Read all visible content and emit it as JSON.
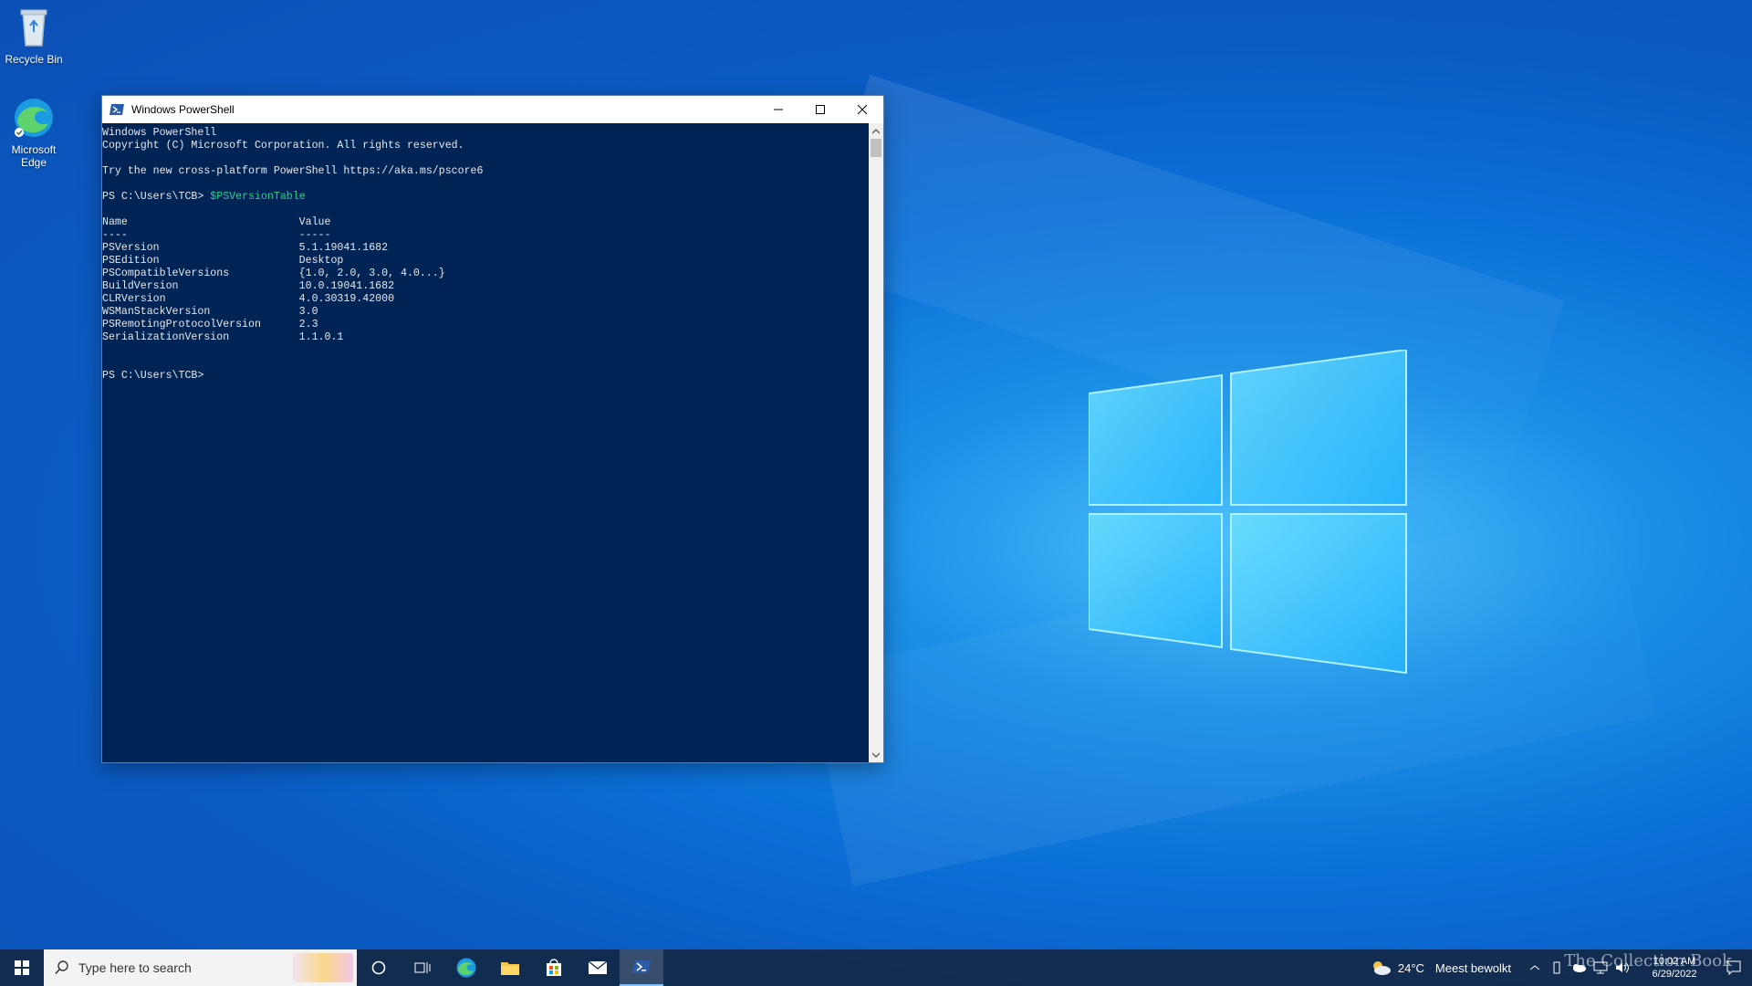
{
  "desktop": {
    "icons": [
      {
        "label": "Recycle Bin"
      },
      {
        "label": "Microsoft Edge"
      }
    ]
  },
  "window": {
    "title": "Windows PowerShell",
    "console_lines": [
      "Windows PowerShell",
      "Copyright (C) Microsoft Corporation. All rights reserved.",
      "",
      "Try the new cross-platform PowerShell https://aka.ms/pscore6",
      ""
    ],
    "prompt": "PS C:\\Users\\TCB>",
    "command": "$PSVersionTable",
    "table_header": [
      "Name",
      "Value"
    ],
    "table_underline": [
      "----",
      "-----"
    ],
    "table_rows": [
      [
        "PSVersion",
        "5.1.19041.1682"
      ],
      [
        "PSEdition",
        "Desktop"
      ],
      [
        "PSCompatibleVersions",
        "{1.0, 2.0, 3.0, 4.0...}"
      ],
      [
        "BuildVersion",
        "10.0.19041.1682"
      ],
      [
        "CLRVersion",
        "4.0.30319.42000"
      ],
      [
        "WSManStackVersion",
        "3.0"
      ],
      [
        "PSRemotingProtocolVersion",
        "2.3"
      ],
      [
        "SerializationVersion",
        "1.1.0.1"
      ]
    ],
    "final_prompt": "PS C:\\Users\\TCB>"
  },
  "taskbar": {
    "search_placeholder": "Type here to search",
    "weather_temp": "24°C",
    "weather_desc": "Meest bewolkt",
    "time": "10:02 AM",
    "date": "6/29/2022",
    "watermark": "The Collection Book"
  },
  "colors": {
    "console_bg": "#012456",
    "command_green": "#23d18b",
    "accent": "#0078d7"
  }
}
